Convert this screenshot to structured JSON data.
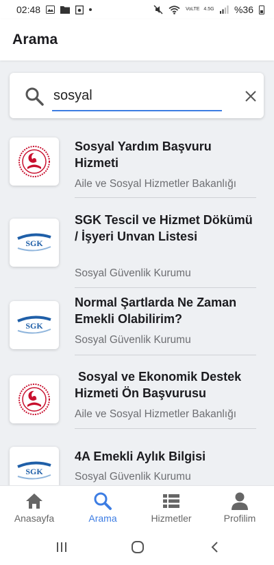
{
  "status_bar": {
    "time": "02:48",
    "left_icons": [
      "image-icon",
      "folder-icon",
      "media-icon",
      "dot-icon"
    ],
    "right_icons": [
      "mute-icon",
      "wifi-icon",
      "volte-icon",
      "signal-4g-icon",
      "battery-icon"
    ],
    "volte_label": "VoLTE",
    "network_label": "4.5G",
    "battery": "%36"
  },
  "app_bar": {
    "title": "Arama"
  },
  "search": {
    "value": "sosyal",
    "search_icon": "search-icon",
    "clear_icon": "close-icon"
  },
  "results": [
    {
      "title": "Sosyal Yardım Başvuru Hizmeti",
      "subtitle": "Aile ve Sosyal Hizmetler Bakanlığı",
      "logo": "aile-bakanligi-logo"
    },
    {
      "title": "SGK Tescil ve Hizmet Dökümü / İşyeri Unvan Listesi",
      "subtitle": "Sosyal Güvenlik Kurumu",
      "logo": "sgk-logo",
      "logo_text": "SGK"
    },
    {
      "title": "Normal Şartlarda Ne Zaman Emekli Olabilirim?",
      "subtitle": "Sosyal Güvenlik Kurumu",
      "logo": "sgk-logo",
      "logo_text": "SGK"
    },
    {
      "title": " Sosyal ve Ekonomik Destek Hizmeti Ön Başvurusu",
      "subtitle": "Aile ve Sosyal Hizmetler Bakanlığı",
      "logo": "aile-bakanligi-logo"
    },
    {
      "title": "4A Emekli Aylık Bilgisi",
      "subtitle": "Sosyal Güvenlik Kurumu",
      "logo": "sgk-logo",
      "logo_text": "SGK"
    }
  ],
  "bottom_nav": [
    {
      "label": "Anasayfa",
      "icon": "home-icon",
      "active": false
    },
    {
      "label": "Arama",
      "icon": "search-icon",
      "active": true
    },
    {
      "label": "Hizmetler",
      "icon": "list-icon",
      "active": false
    },
    {
      "label": "Profilim",
      "icon": "person-icon",
      "active": false
    }
  ],
  "system_nav": [
    "recents-icon",
    "home-circle-icon",
    "back-icon"
  ],
  "colors": {
    "accent": "#3d7de3",
    "inactive": "#666666",
    "ministry_red": "#c8102e",
    "sgk_blue": "#1f5fa8"
  }
}
